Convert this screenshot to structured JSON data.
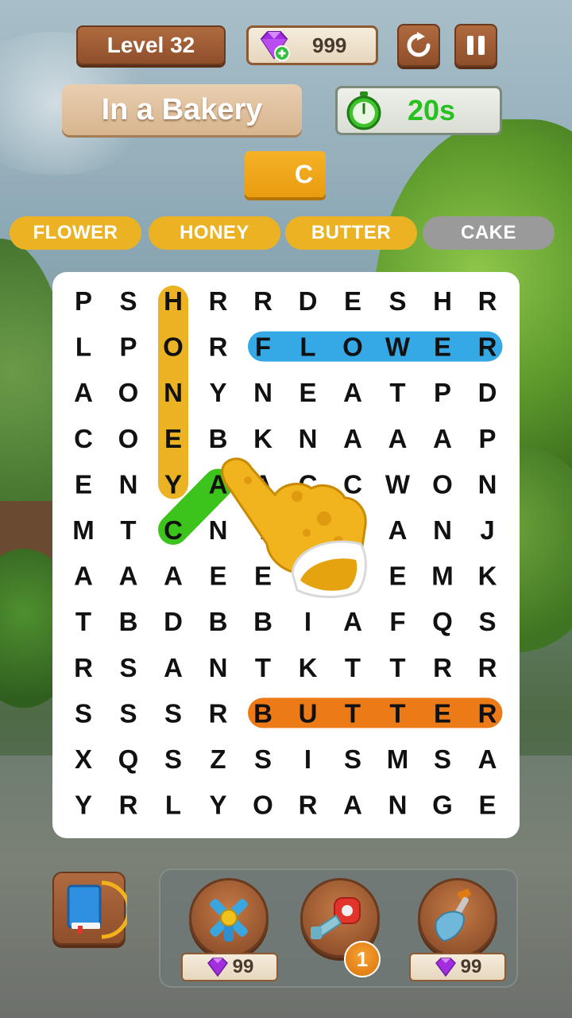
{
  "header": {
    "level_label": "Level 32",
    "gem_count": "999",
    "icons": [
      "gem-icon",
      "restart-icon",
      "pause-icon"
    ]
  },
  "category": "In a Bakery",
  "timer": {
    "value": "20s",
    "icon": "stopwatch-icon"
  },
  "current_selection": "C",
  "words": [
    {
      "text": "FLOWER",
      "found": true
    },
    {
      "text": "HONEY",
      "found": true
    },
    {
      "text": "BUTTER",
      "found": true
    },
    {
      "text": "CAKE",
      "found": false
    }
  ],
  "grid": [
    [
      "P",
      "S",
      "H",
      "R",
      "R",
      "D",
      "E",
      "S",
      "H",
      "R"
    ],
    [
      "L",
      "P",
      "O",
      "R",
      "F",
      "L",
      "O",
      "W",
      "E",
      "R"
    ],
    [
      "A",
      "O",
      "N",
      "Y",
      "N",
      "E",
      "A",
      "T",
      "P",
      "D"
    ],
    [
      "C",
      "O",
      "E",
      "B",
      "K",
      "N",
      "A",
      "A",
      "A",
      "P"
    ],
    [
      "E",
      "N",
      "Y",
      "A",
      "A",
      "C",
      "C",
      "W",
      "O",
      "N"
    ],
    [
      "M",
      "T",
      "C",
      "N",
      "T",
      "E",
      "C",
      "A",
      "N",
      "J"
    ],
    [
      "A",
      "A",
      "A",
      "E",
      "E",
      "E",
      "E",
      "E",
      "M",
      "K"
    ],
    [
      "T",
      "B",
      "D",
      "B",
      "B",
      "I",
      "A",
      "F",
      "Q",
      "S"
    ],
    [
      "R",
      "S",
      "A",
      "N",
      "T",
      "K",
      "T",
      "T",
      "R",
      "R"
    ],
    [
      "S",
      "S",
      "S",
      "R",
      "B",
      "U",
      "T",
      "T",
      "E",
      "R"
    ],
    [
      "X",
      "Q",
      "S",
      "Z",
      "S",
      "I",
      "S",
      "M",
      "S",
      "A"
    ],
    [
      "Y",
      "R",
      "L",
      "Y",
      "O",
      "R",
      "A",
      "N",
      "G",
      "E"
    ]
  ],
  "highlights": [
    {
      "word": "HONEY",
      "color": "#ebb323",
      "from": [
        0,
        2
      ],
      "to": [
        4,
        2
      ]
    },
    {
      "word": "FLOWER",
      "color": "#35a9e6",
      "from": [
        1,
        4
      ],
      "to": [
        1,
        9
      ]
    },
    {
      "word": "BUTTER",
      "color": "#ec7a16",
      "from": [
        9,
        4
      ],
      "to": [
        9,
        9
      ]
    },
    {
      "word": "CAKE",
      "color": "#3cc31c",
      "from": [
        5,
        2
      ],
      "to": [
        4,
        3
      ],
      "in_progress": true
    }
  ],
  "colors": {
    "found_letter_default": "#111111",
    "found_letter_on_highlight": "#1a1a1a",
    "word_found": "#ebb323",
    "word_pending": "#9a9a9a",
    "timer_text": "#27c01f",
    "accent_orange": "#f6b227"
  },
  "boosters": [
    {
      "icon": "magnet-cross-icon",
      "price": "99"
    },
    {
      "icon": "hair-dryer-icon",
      "count": "1"
    },
    {
      "icon": "shovel-icon",
      "price": "99"
    }
  ],
  "book_icon": "book-icon",
  "pointer_icon": "pointing-hand-icon"
}
